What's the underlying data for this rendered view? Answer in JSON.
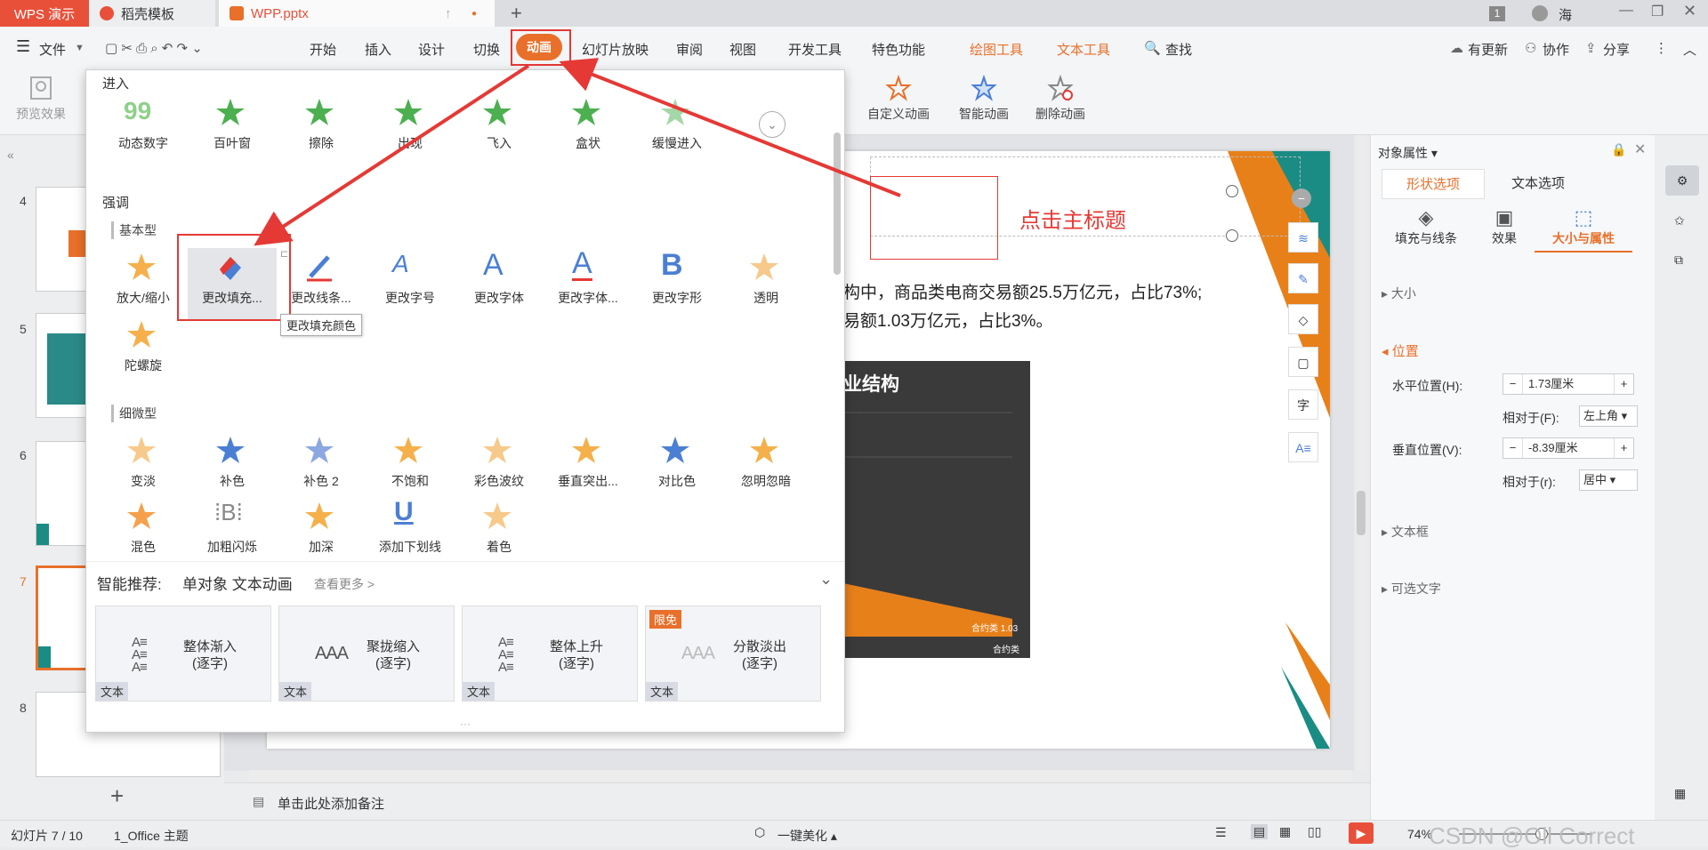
{
  "titlebar": {
    "app_tab": "WPS 演示",
    "tabs": [
      {
        "label": "稻壳模板"
      },
      {
        "label": "WPP.pptx"
      }
    ],
    "add_tab": "+",
    "user_badge": "1",
    "user_name": "海"
  },
  "menubar": {
    "file_menu": "文件",
    "items": [
      "开始",
      "插入",
      "设计",
      "切换",
      "动画",
      "幻灯片放映",
      "审阅",
      "视图",
      "开发工具",
      "特色功能"
    ],
    "context_tabs": [
      "绘图工具",
      "文本工具"
    ],
    "search": "查找",
    "right": {
      "update": "有更新",
      "collab": "协作",
      "share": "分享"
    }
  },
  "ribbon": {
    "preview": "预览效果",
    "custom_anim": "自定义动画",
    "smart_anim": "智能动画",
    "delete_anim": "删除动画"
  },
  "dropdown": {
    "section_enter": "进入",
    "enter_effects": [
      "动态数字",
      "百叶窗",
      "擦除",
      "出现",
      "飞入",
      "盒状",
      "缓慢进入"
    ],
    "section_emphasis": "强调",
    "sub_basic": "基本型",
    "basic_effects": [
      "放大/缩小",
      "更改填充...",
      "更改线条...",
      "更改字号",
      "更改字体",
      "更改字体...",
      "更改字形",
      "透明",
      "陀螺旋"
    ],
    "tooltip": "更改填充颜色",
    "sub_subtle": "细微型",
    "subtle_effects": [
      "变淡",
      "补色",
      "补色 2",
      "不饱和",
      "彩色波纹",
      "垂直突出...",
      "对比色",
      "忽明忽暗",
      "混色",
      "加粗闪烁",
      "加深",
      "添加下划线",
      "着色"
    ],
    "smart_title": "智能推荐:",
    "smart_sub": "单对象 文本动画",
    "smart_more": "查看更多 >",
    "cards": [
      {
        "title": "整体渐入",
        "sub": "(逐字)",
        "tag": "文本"
      },
      {
        "title": "聚拢缩入",
        "sub": "(逐字)",
        "tag": "文本"
      },
      {
        "title": "整体上升",
        "sub": "(逐字)",
        "tag": "文本"
      },
      {
        "title": "分散淡出",
        "sub": "(逐字)",
        "tag": "文本",
        "badge": "限免"
      }
    ]
  },
  "thumbs": [
    {
      "num": "4"
    },
    {
      "num": "5"
    },
    {
      "num": "6"
    },
    {
      "num": "7"
    },
    {
      "num": "8"
    }
  ],
  "slide": {
    "annotation": "点击主标题",
    "line1": "构中，商品类电商交易额25.5万亿元，占比73%;",
    "line2": "易额1.03万亿元，占比3%。",
    "chart_title": "业结构",
    "chart_label1": "合约类",
    "chart_value1": "1.03",
    "chart_label2": "合约类"
  },
  "panel": {
    "title": "对象属性",
    "tabs": [
      "形状选项",
      "文本选项"
    ],
    "subtabs": [
      "填充与线条",
      "效果",
      "大小与属性"
    ],
    "size": "大小",
    "position": "位置",
    "h_pos_label": "水平位置(H):",
    "h_pos_value": "1.73厘米",
    "rel_f_label": "相对于(F):",
    "rel_f_value": "左上角",
    "v_pos_label": "垂直位置(V):",
    "v_pos_value": "-8.39厘米",
    "rel_r_label": "相对于(r):",
    "rel_r_value": "居中",
    "textbox": "文本框",
    "alt_text": "可选文字"
  },
  "notes": "单击此处添加备注",
  "status": {
    "slide_info": "幻灯片 7 / 10",
    "theme": "1_Office 主题",
    "beautify": "一键美化",
    "zoom": "74%",
    "watermark": "CSDN @Oll Correct"
  },
  "colors": {
    "accent": "#e8702a",
    "annotation_red": "#e53935",
    "teal": "#1a8c84"
  }
}
